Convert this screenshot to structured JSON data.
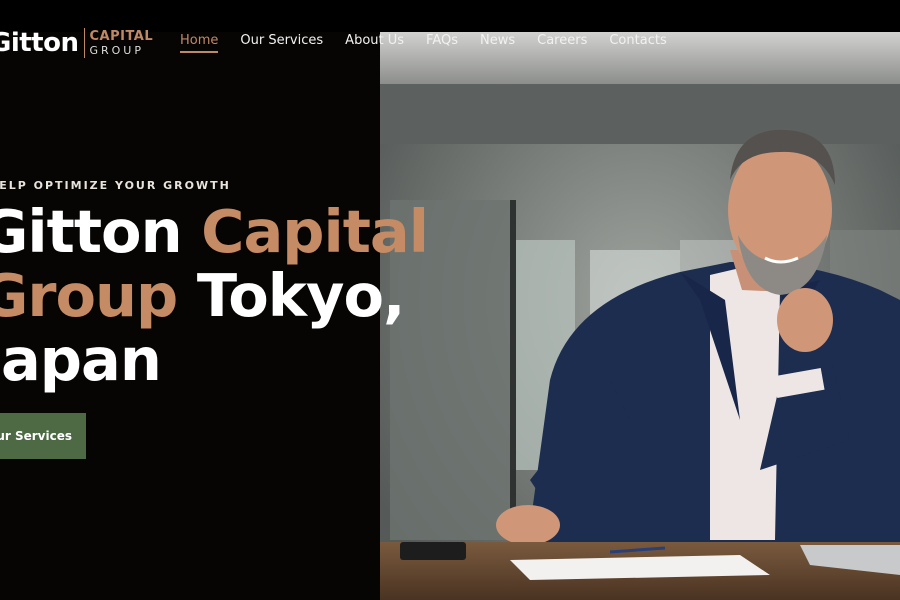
{
  "brand": {
    "name": "Gitton",
    "capital": "CAPITAL",
    "group": "GROUP"
  },
  "nav": {
    "items": [
      {
        "label": "Home",
        "active": true
      },
      {
        "label": "Our Services"
      },
      {
        "label": "About Us"
      },
      {
        "label": "FAQs"
      },
      {
        "label": "News"
      },
      {
        "label": "Careers"
      },
      {
        "label": "Contacts"
      }
    ]
  },
  "hero": {
    "eyebrow": "HELP OPTIMIZE YOUR GROWTH",
    "line1_a": "Gitton ",
    "line1_b": "Capital",
    "line2_a": "Group",
    "line2_b": " Tokyo,",
    "line3": "Japan",
    "cta": "Our Services"
  },
  "colors": {
    "accent": "#c08966",
    "cta_bg": "#4e6a44",
    "bg": "#070504"
  },
  "photo": {
    "subject": "smiling businessman in navy suit at office desk"
  }
}
